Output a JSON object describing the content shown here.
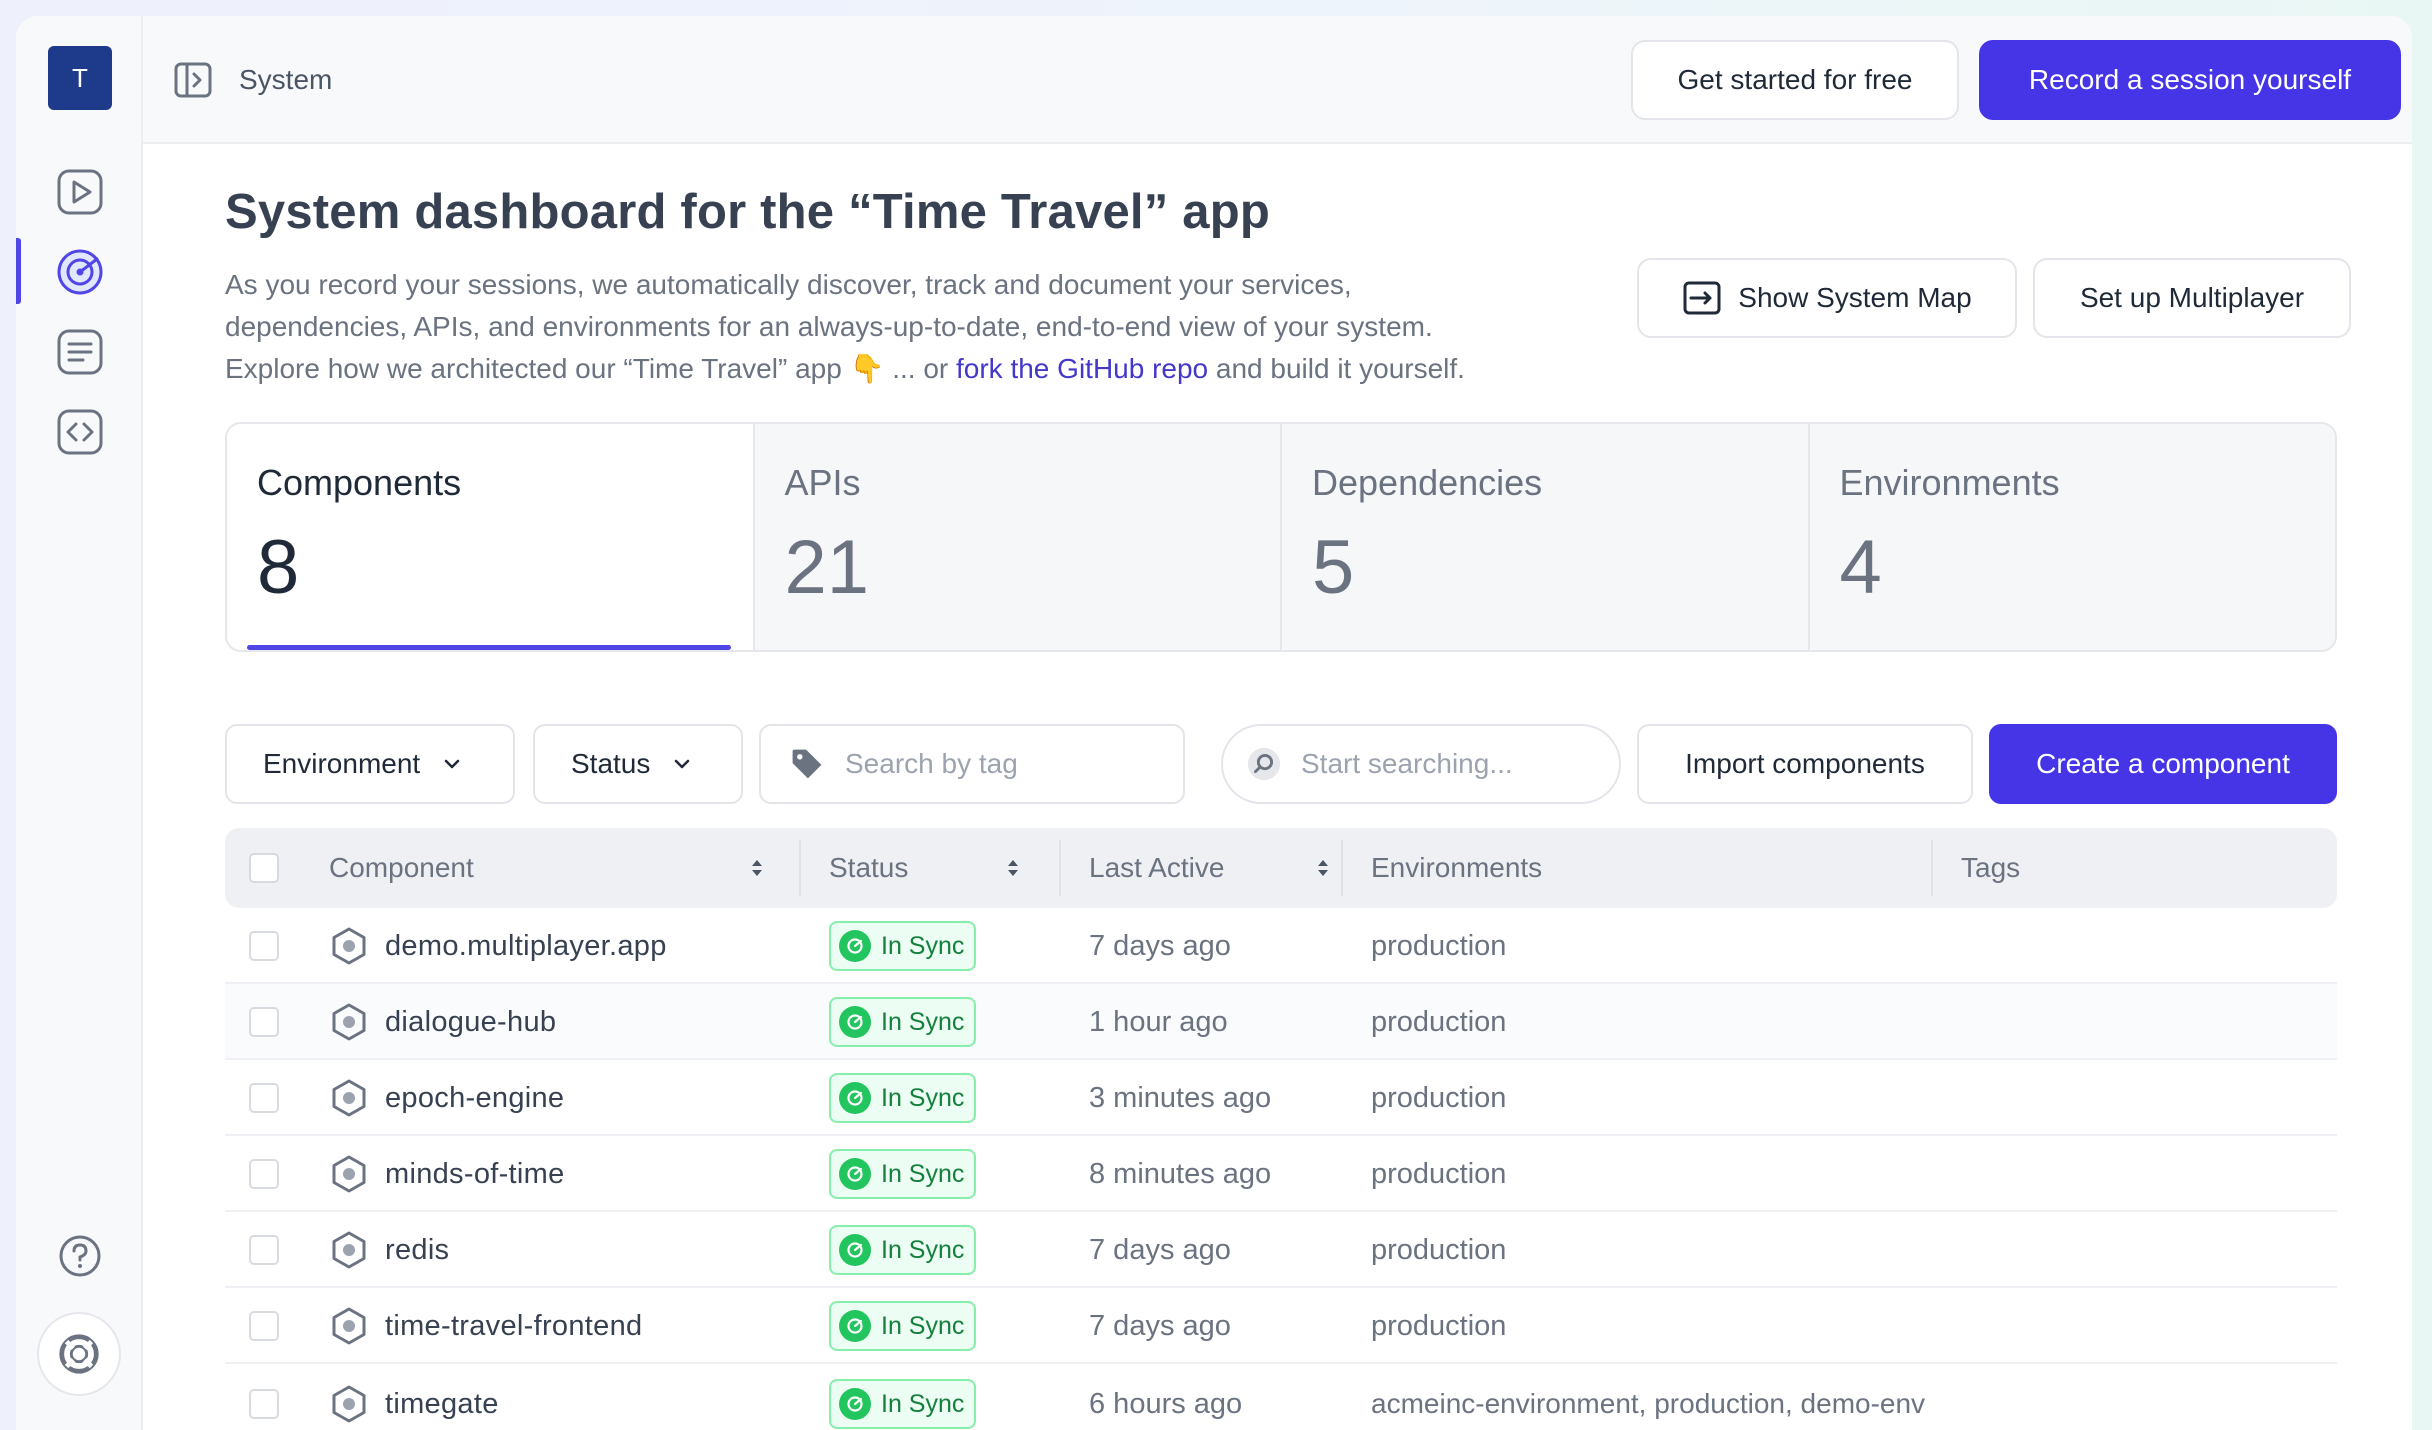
{
  "app": {
    "logo_letter": "T",
    "breadcrumb": "System"
  },
  "sidebar": {
    "items": [
      {
        "name": "sessions",
        "icon": "play-icon"
      },
      {
        "name": "system",
        "icon": "system-dashboard-icon",
        "active": true
      },
      {
        "name": "notebooks",
        "icon": "document-icon"
      },
      {
        "name": "code",
        "icon": "code-icon"
      }
    ],
    "footer": [
      {
        "name": "help",
        "icon": "help-icon"
      },
      {
        "name": "support",
        "icon": "lifebuoy-icon"
      }
    ]
  },
  "header": {
    "get_started_label": "Get started for free",
    "record_label": "Record a session yourself"
  },
  "page": {
    "title": "System dashboard for the “Time Travel” app",
    "description_line1": "As you record your sessions, we automatically discover, track and document your services,",
    "description_line2": "dependencies, APIs, and environments for an always-up-to-date, end-to-end view of your system.",
    "description_line3_prefix": "Explore how we architected our “Time Travel” app 👇 ... or ",
    "description_link": "fork the GitHub repo",
    "description_line3_suffix": " and build it yourself.",
    "show_map_label": "Show System Map",
    "setup_multiplayer_label": "Set up Multiplayer"
  },
  "stats": [
    {
      "label": "Components",
      "value": "8",
      "active": true
    },
    {
      "label": "APIs",
      "value": "21"
    },
    {
      "label": "Dependencies",
      "value": "5"
    },
    {
      "label": "Environments",
      "value": "4"
    }
  ],
  "filters": {
    "environment_label": "Environment",
    "status_label": "Status",
    "tag_search_placeholder": "Search by tag",
    "search_placeholder": "Start searching...",
    "import_label": "Import components",
    "create_label": "Create a component"
  },
  "table": {
    "columns": [
      "Component",
      "Status",
      "Last Active",
      "Environments",
      "Tags"
    ],
    "rows": [
      {
        "name": "demo.multiplayer.app",
        "status": "In Sync",
        "last_active": "7 days ago",
        "environments": "production",
        "tags": ""
      },
      {
        "name": "dialogue-hub",
        "status": "In Sync",
        "last_active": "1 hour ago",
        "environments": "production",
        "tags": ""
      },
      {
        "name": "epoch-engine",
        "status": "In Sync",
        "last_active": "3 minutes ago",
        "environments": "production",
        "tags": ""
      },
      {
        "name": "minds-of-time",
        "status": "In Sync",
        "last_active": "8 minutes ago",
        "environments": "production",
        "tags": ""
      },
      {
        "name": "redis",
        "status": "In Sync",
        "last_active": "7 days ago",
        "environments": "production",
        "tags": ""
      },
      {
        "name": "time-travel-frontend",
        "status": "In Sync",
        "last_active": "7 days ago",
        "environments": "production",
        "tags": ""
      },
      {
        "name": "timegate",
        "status": "In Sync",
        "last_active": "6 hours ago",
        "environments": "acmeinc-environment, production, demo-env",
        "tags": ""
      }
    ]
  },
  "colors": {
    "accent": "#4535e6",
    "logo_bg": "#1e3a8a",
    "sync_green": "#22c55e",
    "sync_bg": "#ecfdf3"
  }
}
